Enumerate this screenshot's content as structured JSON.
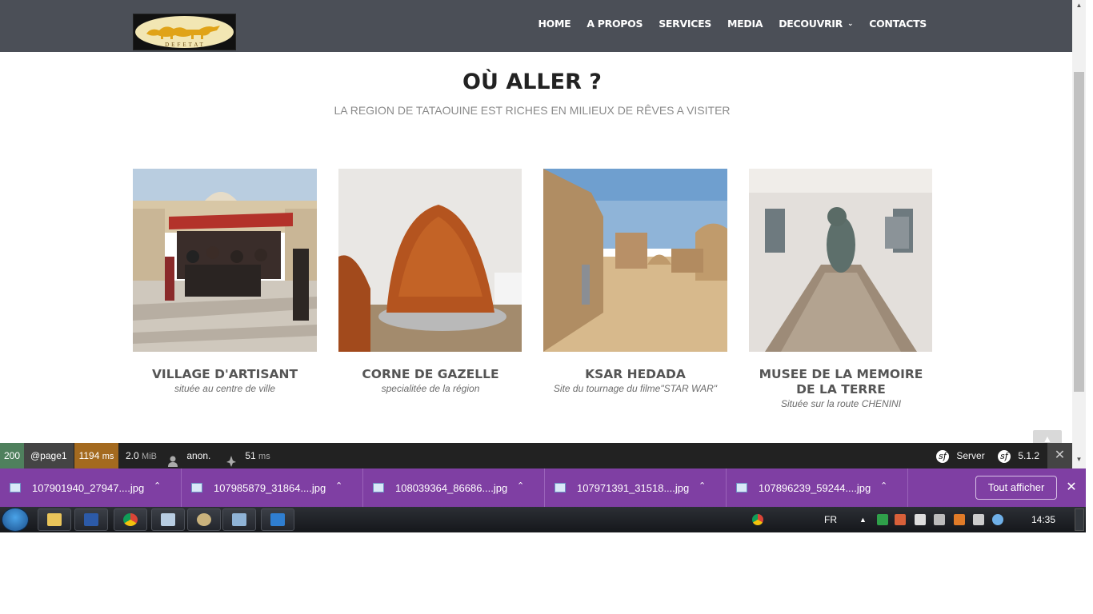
{
  "header": {
    "logo_text": "DEFETAT",
    "nav": [
      {
        "label": "HOME"
      },
      {
        "label": "A PROPOS"
      },
      {
        "label": "SERVICES"
      },
      {
        "label": "MEDIA"
      },
      {
        "label": "DECOUVRIR",
        "has_dropdown": true
      },
      {
        "label": "CONTACTS"
      }
    ]
  },
  "section": {
    "title": "OÙ ALLER ?",
    "subtitle": "LA REGION DE TATAOUINE EST RICHES EN MILIEUX DE RÊVES A VISITER"
  },
  "cards": [
    {
      "title": "VILLAGE D'ARTISANT",
      "subtitle": "située au centre de ville"
    },
    {
      "title": "CORNE DE GAZELLE",
      "subtitle": "specialitée de la région"
    },
    {
      "title": "KSAR HEDADA",
      "subtitle": "Site du tournage du filme\"STAR WAR\""
    },
    {
      "title": "MUSEE DE LA MEMOIRE DE LA TERRE",
      "subtitle": "Située sur la route CHENINI"
    }
  ],
  "debug_toolbar": {
    "status": "200",
    "route": "@page1",
    "time": "1194",
    "time_unit": "ms",
    "memory": "2.0",
    "memory_unit": "MiB",
    "user": "anon.",
    "db_time": "51",
    "db_unit": "ms",
    "server": "Server",
    "version": "5.1.2"
  },
  "downloads": {
    "items": [
      {
        "name": "107901940_27947....jpg"
      },
      {
        "name": "107985879_31864....jpg"
      },
      {
        "name": "108039364_86686....jpg"
      },
      {
        "name": "107971391_31518....jpg"
      },
      {
        "name": "107896239_59244....jpg"
      }
    ],
    "show_all": "Tout afficher"
  },
  "taskbar": {
    "language": "FR",
    "clock": "14:35"
  },
  "colors": {
    "header_bg": "#4b4f57",
    "downloads_bg": "#7f3fa3",
    "status_ok": "#4f805d",
    "time_badge": "#a46a1f"
  }
}
